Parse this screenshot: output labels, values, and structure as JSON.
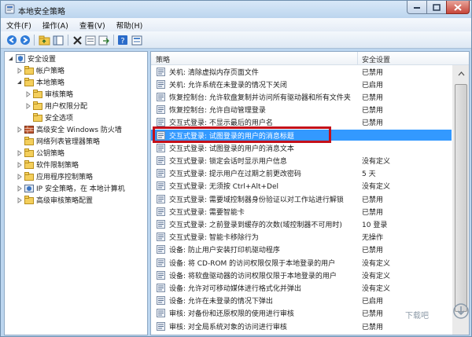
{
  "window": {
    "title": "本地安全策略",
    "controls": {
      "minimize": "–",
      "maximize": "□",
      "close": "✕"
    }
  },
  "menu": [
    "文件(F)",
    "操作(A)",
    "查看(V)",
    "帮助(H)"
  ],
  "toolbar_icons": [
    "back-icon",
    "forward-icon",
    "up-folder-icon",
    "show-tree-icon",
    "delete-icon",
    "properties-icon",
    "export-icon",
    "help-icon",
    "view-icon"
  ],
  "tree": [
    {
      "label": "安全设置",
      "icon": "security-settings-icon",
      "expanded": true
    },
    {
      "label": "帐户策略",
      "icon": "folder-icon",
      "expanded": false
    },
    {
      "label": "本地策略",
      "icon": "folder-icon",
      "expanded": true
    },
    {
      "label": "审核策略",
      "icon": "folder-icon",
      "expanded": false
    },
    {
      "label": "用户权限分配",
      "icon": "folder-icon",
      "expanded": false
    },
    {
      "label": "安全选项",
      "icon": "folder-icon",
      "expanded": false
    },
    {
      "label": "高级安全 Windows 防火墙",
      "icon": "firewall-icon",
      "expanded": false
    },
    {
      "label": "网络列表管理器策略",
      "icon": "folder-icon",
      "expanded": false
    },
    {
      "label": "公钥策略",
      "icon": "folder-icon",
      "expanded": false
    },
    {
      "label": "软件限制策略",
      "icon": "folder-icon",
      "expanded": false
    },
    {
      "label": "应用程序控制策略",
      "icon": "folder-icon",
      "expanded": false
    },
    {
      "label": "IP 安全策略，在 本地计算机",
      "icon": "ip-security-icon",
      "expanded": false
    },
    {
      "label": "高级审核策略配置",
      "icon": "folder-icon",
      "expanded": false
    }
  ],
  "list": {
    "columns": [
      "策略",
      "安全设置"
    ],
    "rows": [
      {
        "name": "关机: 清除虚拟内存页面文件",
        "value": "已禁用",
        "selected": false
      },
      {
        "name": "关机: 允许系统在未登录的情况下关闭",
        "value": "已启用",
        "selected": false
      },
      {
        "name": "恢复控制台: 允许软盘复制并访问所有驱动器和所有文件夹",
        "value": "已禁用",
        "selected": false
      },
      {
        "name": "恢复控制台: 允许自动管理登录",
        "value": "已禁用",
        "selected": false
      },
      {
        "name": "交互式登录: 不显示最后的用户名",
        "value": "已禁用",
        "selected": false
      },
      {
        "name": "交互式登录: 试图登录的用户的消息标题",
        "value": "",
        "selected": true
      },
      {
        "name": "交互式登录: 试图登录的用户的消息文本",
        "value": "",
        "selected": false
      },
      {
        "name": "交互式登录: 锁定会话时显示用户信息",
        "value": "没有定义",
        "selected": false
      },
      {
        "name": "交互式登录: 提示用户在过期之前更改密码",
        "value": "5 天",
        "selected": false
      },
      {
        "name": "交互式登录: 无须按 Ctrl+Alt+Del",
        "value": "没有定义",
        "selected": false
      },
      {
        "name": "交互式登录: 需要域控制器身份验证以对工作站进行解锁",
        "value": "已禁用",
        "selected": false
      },
      {
        "name": "交互式登录: 需要智能卡",
        "value": "已禁用",
        "selected": false
      },
      {
        "name": "交互式登录: 之前登录到缓存的次数(域控制器不可用时)",
        "value": "10 登录",
        "selected": false
      },
      {
        "name": "交互式登录: 智能卡移除行为",
        "value": "无操作",
        "selected": false
      },
      {
        "name": "设备: 防止用户安装打印机驱动程序",
        "value": "已禁用",
        "selected": false
      },
      {
        "name": "设备: 将 CD-ROM 的访问权限仅限于本地登录的用户",
        "value": "没有定义",
        "selected": false
      },
      {
        "name": "设备: 将软盘驱动器的访问权限仅限于本地登录的用户",
        "value": "没有定义",
        "selected": false
      },
      {
        "name": "设备: 允许对可移动媒体进行格式化并弹出",
        "value": "没有定义",
        "selected": false
      },
      {
        "name": "设备: 允许在未登录的情况下弹出",
        "value": "已启用",
        "selected": false
      },
      {
        "name": "审核: 对备份和还原权限的使用进行审核",
        "value": "已禁用",
        "selected": false
      },
      {
        "name": "审核: 对全局系统对象的访问进行审核",
        "value": "已禁用",
        "selected": false
      }
    ]
  },
  "watermark": "下载吧",
  "colors": {
    "selection": "#3399ff",
    "highlight_box": "#c4101a"
  }
}
